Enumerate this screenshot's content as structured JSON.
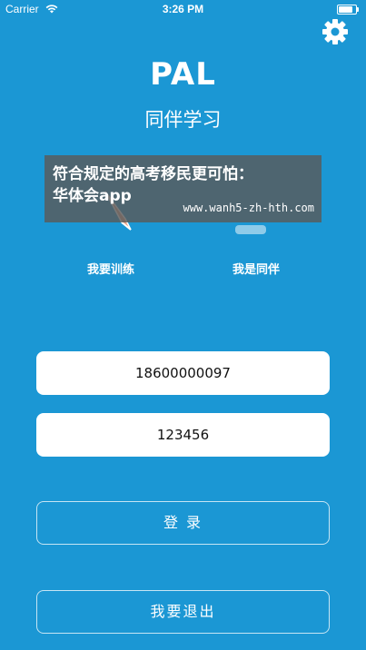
{
  "status_bar": {
    "carrier": "Carrier",
    "time": "3:26 PM",
    "wifi_icon": "wifi-icon",
    "battery_icon": "battery-icon"
  },
  "header": {
    "settings_icon": "gear-icon",
    "title": "PAL",
    "subtitle": "同伴学习"
  },
  "modes": [
    {
      "label": "我要训练",
      "icon": "pen-icon"
    },
    {
      "label": "我是同伴",
      "icon": "peer-icon"
    }
  ],
  "login_form": {
    "phone_value": "18600000097",
    "password_value": "123456",
    "login_label": "登 录",
    "logout_label": "我要退出"
  },
  "watermark": {
    "line1": "符合规定的高考移民更可怕：",
    "line2": "华体会app",
    "url": "www.wanh5-zh-hth.com"
  },
  "colors": {
    "background": "#1b97d4",
    "input_background": "#ffffff",
    "text": "#ffffff"
  }
}
